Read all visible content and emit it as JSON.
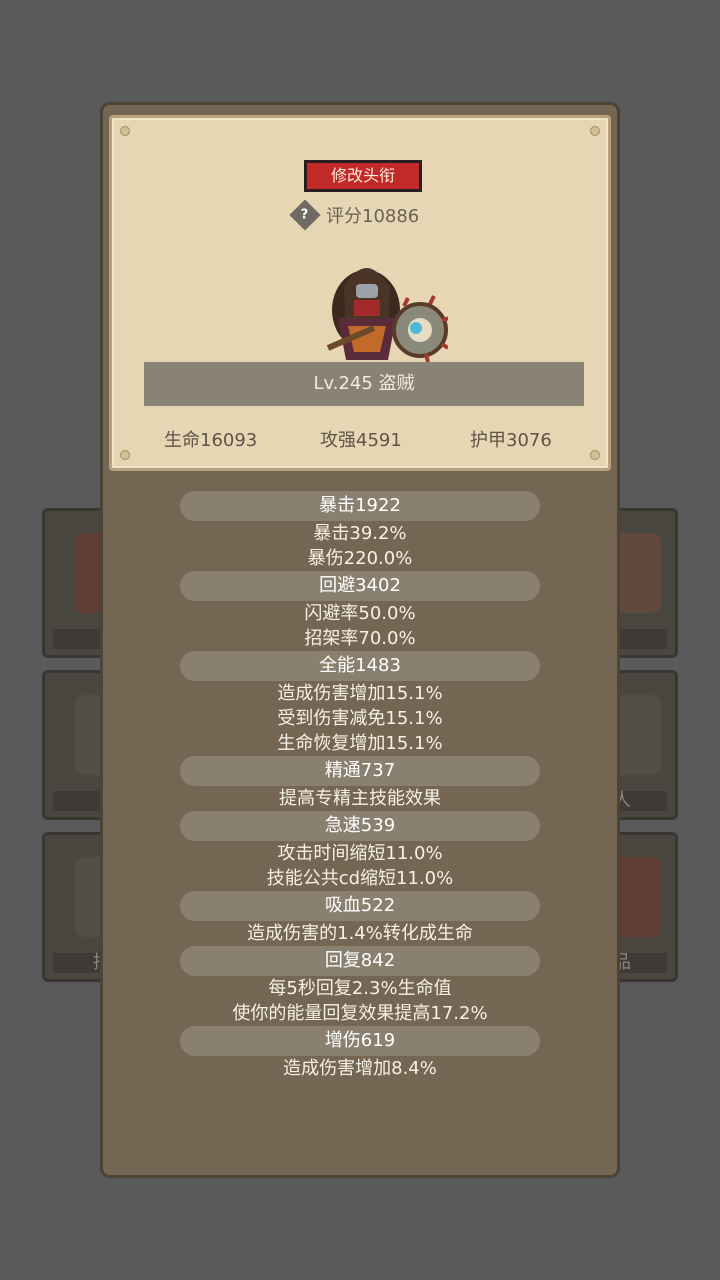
{
  "background": {
    "cards": [
      {
        "label": ""
      },
      {
        "label": ""
      },
      {
        "label": "招"
      },
      {
        "label": ""
      },
      {
        "label": "人"
      },
      {
        "label": "品"
      }
    ]
  },
  "header": {
    "title_button": "修改头衔",
    "help_icon": "question-diamond-icon",
    "score": "评分10886",
    "level_class": "Lv.245 盗贼",
    "stats": {
      "hp": "生命16093",
      "attack": "攻强4591",
      "armor": "护甲3076"
    }
  },
  "attributes": [
    {
      "head": "暴击1922",
      "lines": [
        "暴击39.2%",
        "暴伤220.0%"
      ]
    },
    {
      "head": "回避3402",
      "lines": [
        "闪避率50.0%",
        "招架率70.0%"
      ]
    },
    {
      "head": "全能1483",
      "lines": [
        "造成伤害增加15.1%",
        "受到伤害减免15.1%",
        "生命恢复增加15.1%"
      ]
    },
    {
      "head": "精通737",
      "lines": [
        "提高专精主技能效果"
      ]
    },
    {
      "head": "急速539",
      "lines": [
        "攻击时间缩短11.0%",
        "技能公共cd缩短11.0%"
      ]
    },
    {
      "head": "吸血522",
      "lines": [
        "造成伤害的1.4%转化成生命"
      ]
    },
    {
      "head": "回复842",
      "lines": [
        "每5秒回复2.3%生命值",
        "使你的能量回复效果提高17.2%"
      ]
    },
    {
      "head": "增伤619",
      "lines": [
        "造成伤害增加8.4%"
      ]
    }
  ],
  "colors": {
    "panel": "#746652",
    "parchment": "#e6d6b4",
    "title_button": "#c22a2a"
  }
}
